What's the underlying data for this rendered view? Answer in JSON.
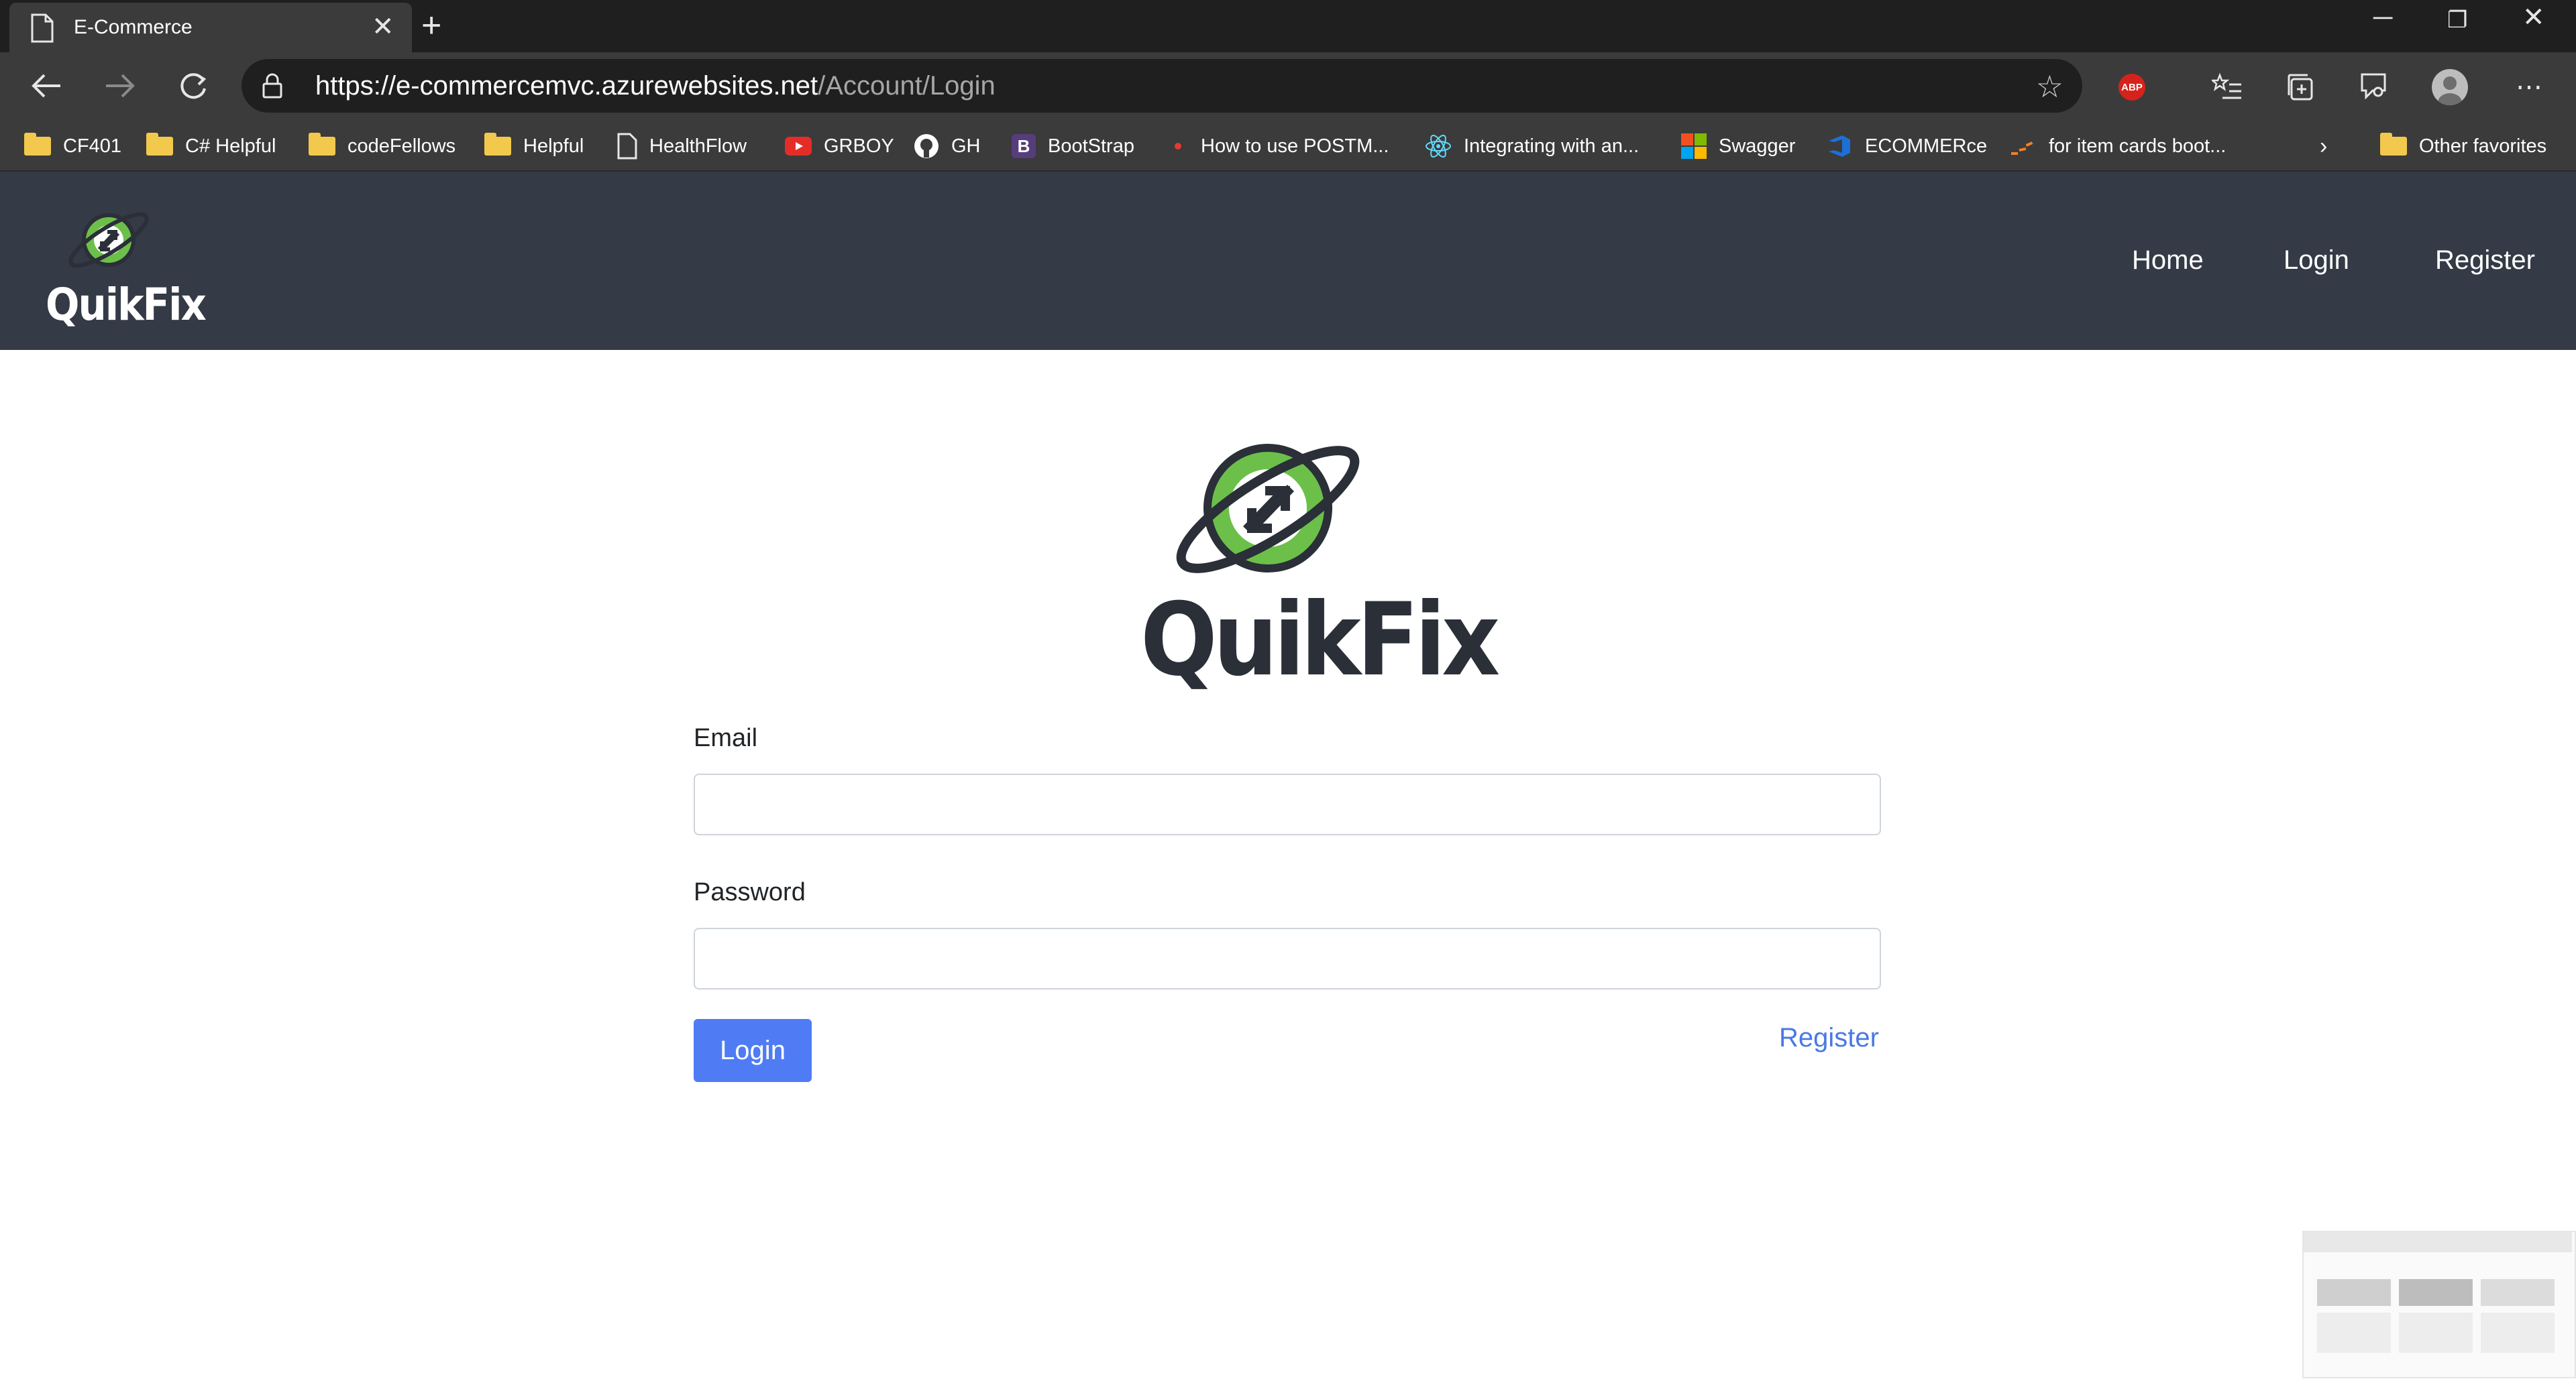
{
  "browser": {
    "tab_title": "E-Commerce",
    "url_host": "https://e-commercemvc.azurewebsites.net",
    "url_path": "/Account/Login",
    "bookmarks": [
      "CF401",
      "C# Helpful",
      "codeFellows",
      "Helpful",
      "HealthFlow",
      "GRBOY",
      "GH",
      "BootStrap",
      "How to use POSTM...",
      "Integrating with an...",
      "Swagger",
      "ECOMMERce",
      "for item cards boot..."
    ],
    "other_favorites": "Other favorites",
    "abp_label": "ABP"
  },
  "site": {
    "brand": "QuikFix",
    "nav": {
      "home": "Home",
      "login": "Login",
      "register": "Register"
    }
  },
  "form": {
    "logo_text": "QuikFix",
    "email_label": "Email",
    "email_value": "",
    "password_label": "Password",
    "password_value": "",
    "login_button": "Login",
    "register_link": "Register"
  },
  "colors": {
    "nav_bg": "#343a46",
    "logo_green": "#6cc04a",
    "primary": "#4f7cf5",
    "link": "#4a78e6"
  }
}
